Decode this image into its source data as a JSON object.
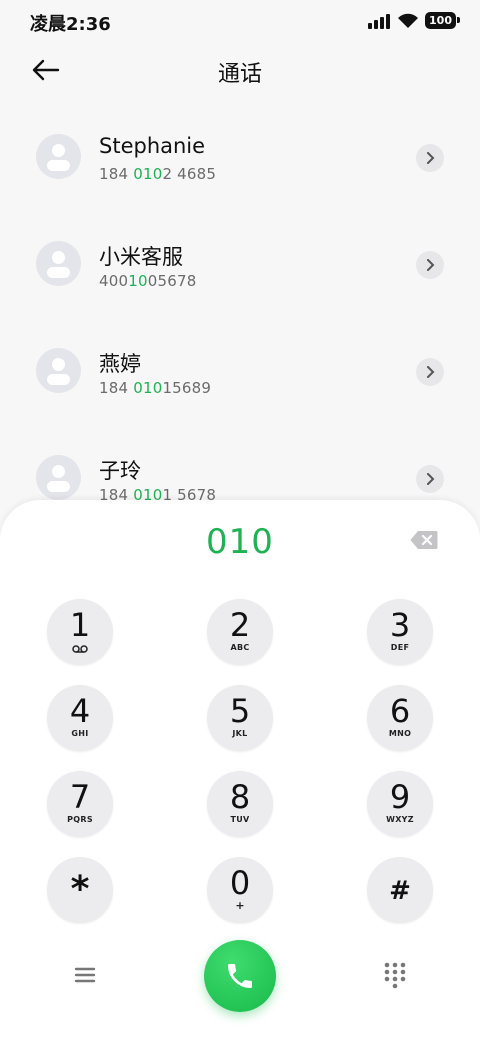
{
  "status_bar": {
    "time": "凌晨2:36",
    "battery": "100"
  },
  "header": {
    "title": "通话"
  },
  "contacts": [
    {
      "name": "Stephanie",
      "number_parts": [
        "184 ",
        "010",
        "2 4685"
      ]
    },
    {
      "name": "小米客服",
      "number_parts": [
        "400",
        "10",
        "05678"
      ]
    },
    {
      "name": "燕婷",
      "number_parts": [
        "184 ",
        "010",
        "15689"
      ]
    },
    {
      "name": "子玲",
      "number_parts": [
        "184 ",
        "010",
        "1 5678"
      ]
    }
  ],
  "dialpad": {
    "dialed": "010",
    "keys": [
      {
        "digit": "1",
        "letters": ""
      },
      {
        "digit": "2",
        "letters": "ABC"
      },
      {
        "digit": "3",
        "letters": "DEF"
      },
      {
        "digit": "4",
        "letters": "GHI"
      },
      {
        "digit": "5",
        "letters": "JKL"
      },
      {
        "digit": "6",
        "letters": "MNO"
      },
      {
        "digit": "7",
        "letters": "PQRS"
      },
      {
        "digit": "8",
        "letters": "TUV"
      },
      {
        "digit": "9",
        "letters": "WXYZ"
      },
      {
        "digit": "*",
        "letters": ""
      },
      {
        "digit": "0",
        "letters": "+"
      },
      {
        "digit": "#",
        "letters": ""
      }
    ]
  },
  "icons": {
    "back": "back-arrow-icon",
    "detail": "chevron-right-icon",
    "backspace": "backspace-icon",
    "voicemail": "voicemail-icon",
    "menu": "menu-icon",
    "call": "phone-icon",
    "keypad": "dialpad-icon"
  },
  "colors": {
    "accent": "#1fb253",
    "key_bg": "#ececee",
    "avatar_bg": "#e4e5ea"
  }
}
